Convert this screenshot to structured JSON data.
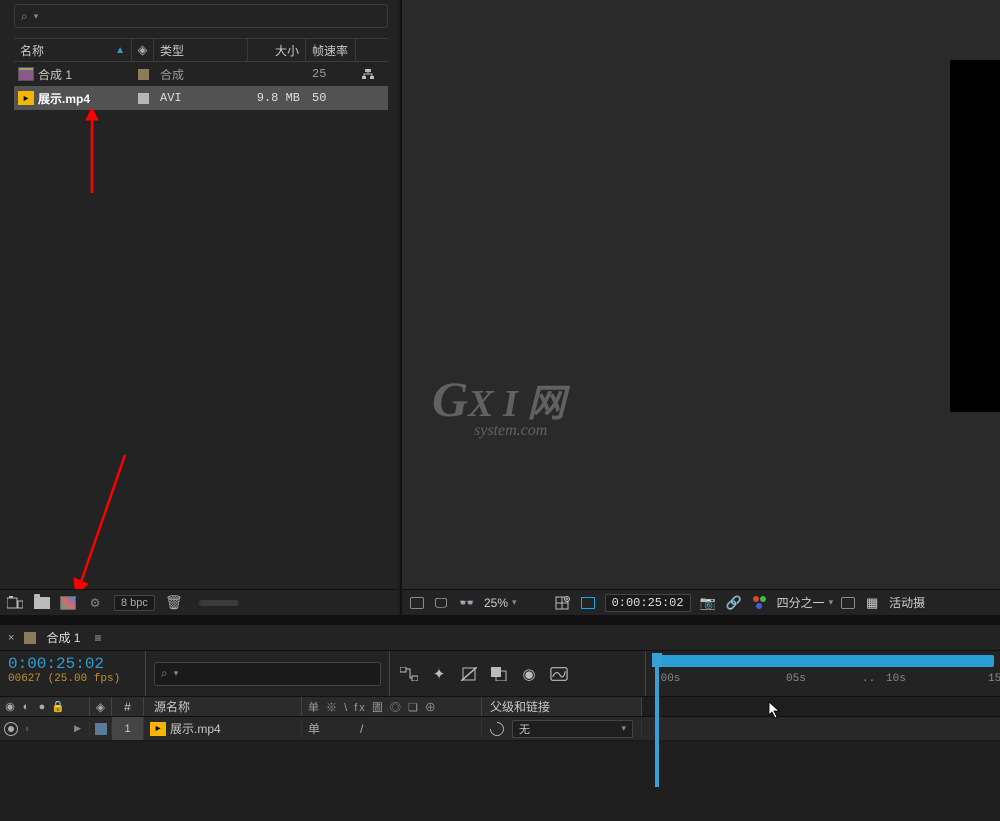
{
  "project": {
    "search_placeholder": "",
    "columns": {
      "name": "名称",
      "type": "类型",
      "size": "大小",
      "fps": "帧速率"
    },
    "rows": [
      {
        "icon": "comp",
        "name": "合成 1",
        "type": "合成",
        "size": "",
        "fps": "25",
        "flow": true
      },
      {
        "icon": "video",
        "name": "展示.mp4",
        "type": "AVI",
        "size": "9.8 MB",
        "fps": "50",
        "flow": false,
        "selected": true
      }
    ],
    "footer": {
      "bpc": "8 bpc"
    }
  },
  "preview": {
    "footer": {
      "zoom": "25%",
      "timecode": "0:00:25:02",
      "resolution": "四分之一",
      "camera": "活动摄"
    }
  },
  "watermark": {
    "big": "G",
    "small": "X I 网",
    "sub": "system.com"
  },
  "timeline": {
    "tab": "合成 1",
    "timecode": "0:00:25:02",
    "frame_info": "00627 (25.00 fps)",
    "columns": {
      "source_name": "源名称",
      "switches": "单 ※ \\ fx 圕 ◎ ❏ ⊕",
      "parent": "父级和链接"
    },
    "ruler": {
      "ticks": [
        ":00s",
        "05s",
        "10s",
        "15"
      ]
    },
    "layers": [
      {
        "num": "1",
        "name": "展示.mp4",
        "switch": "单",
        "parent_value": "无"
      }
    ]
  }
}
